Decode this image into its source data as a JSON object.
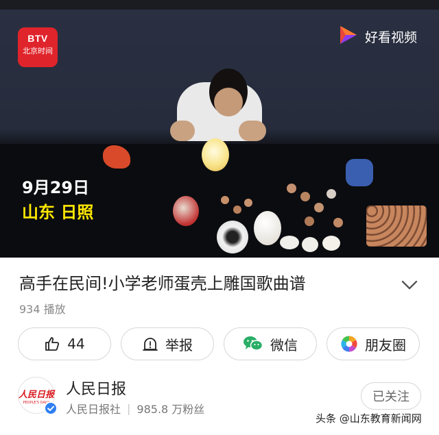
{
  "video": {
    "channel_logo_top": "BTV",
    "channel_logo_bottom": "北京时间",
    "app_logo_text": "好看视频",
    "caption_date": "9月29日",
    "caption_location": "山东 日照"
  },
  "details": {
    "title": "高手在民间!小学老师蛋壳上雕国歌曲谱",
    "plays": "934 播放"
  },
  "actions": {
    "like_count": "44",
    "report_label": "举报",
    "wechat_label": "微信",
    "moments_label": "朋友圈"
  },
  "account": {
    "avatar_logo": "人民日报",
    "avatar_sub": "PEOPLE'S DAILY",
    "name": "人民日报",
    "org": "人民日报社",
    "fans": "985.8 万粉丝",
    "follow_label": "已关注"
  },
  "watermark": "头条 @山东教育新闻网",
  "colors": {
    "btv_red": "#e0242b",
    "caption_yellow": "#ffe800",
    "wechat_green": "#2aae67",
    "verify_blue": "#2f7ff0"
  },
  "icons": [
    "like-icon",
    "report-icon",
    "wechat-icon",
    "moments-icon",
    "chevron-down-icon",
    "verified-icon",
    "haokan-play-icon"
  ]
}
